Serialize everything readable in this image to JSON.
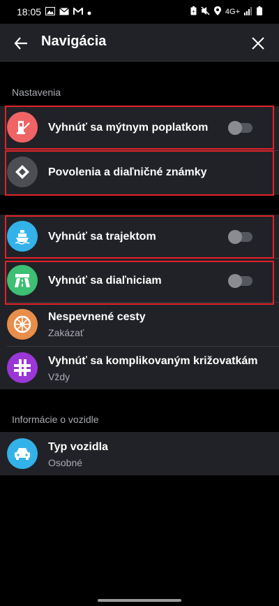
{
  "status_bar": {
    "time": "18:05",
    "network": "4G+",
    "left_icons": [
      "image-icon",
      "mail-icon",
      "gmail-icon",
      "dot-icon"
    ],
    "right_icons": [
      "battery-saver-icon",
      "mute-icon",
      "location-icon",
      "signal-icon",
      "battery-icon"
    ]
  },
  "header": {
    "title": "Navigácia",
    "back_icon": "arrow-left-icon",
    "close_icon": "close-icon"
  },
  "sections": {
    "settings_label": "Nastavenia",
    "vehicle_label": "Informácie o vozidle"
  },
  "rows": {
    "toll": {
      "label": "Vyhnúť sa mýtnym poplatkom",
      "icon": "toll-icon",
      "color": "#f06465",
      "toggle_on": false
    },
    "permits": {
      "label": "Povolenia a diaľničné známky",
      "icon": "diamond-icon",
      "color": "#4d4e54"
    },
    "ferry": {
      "label": "Vyhnúť sa trajektom",
      "icon": "ferry-icon",
      "color": "#33b2ea",
      "toggle_on": false
    },
    "highway": {
      "label": "Vyhnúť sa diaľniciam",
      "icon": "highway-icon",
      "color": "#3dbf74",
      "toggle_on": false
    },
    "unpaved": {
      "label": "Nespevnené cesty",
      "value": "Zakázať",
      "icon": "wheel-icon",
      "color": "#e88e4a"
    },
    "intersections": {
      "label": "Vyhnúť sa komplikovaným križovatkám",
      "value": "Vždy",
      "icon": "intersection-icon",
      "color": "#9a37d6"
    },
    "vehicle": {
      "label": "Typ vozidla",
      "value": "Osobné",
      "icon": "car-icon",
      "color": "#33b2ea"
    }
  },
  "colors": {
    "background": "#000000",
    "card": "#212227",
    "highlight": "#e2232a"
  }
}
